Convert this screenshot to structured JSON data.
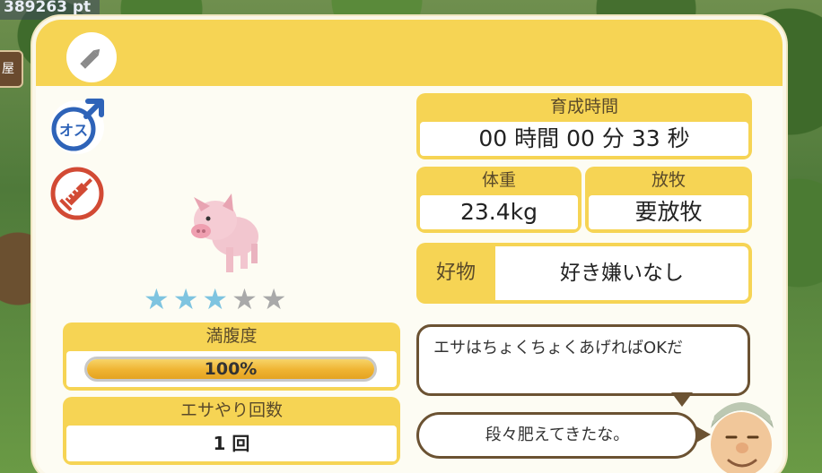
{
  "hud": {
    "points": "389263 pt",
    "side_tag": "屋"
  },
  "panel": {
    "grow_time": {
      "label": "育成時間",
      "value": "00 時間 00 分 33 秒"
    },
    "weight": {
      "label": "体重",
      "value": "23.4kg"
    },
    "grazing": {
      "label": "放牧",
      "value": "要放牧"
    },
    "favorite": {
      "label": "好物",
      "value": "好き嫌いなし"
    },
    "fullness": {
      "label": "満腹度",
      "value_text": "100%",
      "value": 1.0
    },
    "feeding": {
      "label": "エサやり回数",
      "value": "1 回"
    },
    "rating": {
      "filled": 3,
      "total": 5
    },
    "bubbles": [
      "エサはちょくちょくあげればOKだ",
      "段々肥えてきたな。"
    ],
    "icons": {
      "edit": "pencil-icon",
      "gender": "male-icon",
      "gender_text": "オス",
      "vaccine": "syringe-icon"
    }
  },
  "colors": {
    "header": "#f6d454",
    "star_filled": "#7ec4e0",
    "star_empty": "#a9a9a9",
    "male": "#2e63b8",
    "vaccine": "#d24a34",
    "bubble_border": "#6b5232"
  }
}
